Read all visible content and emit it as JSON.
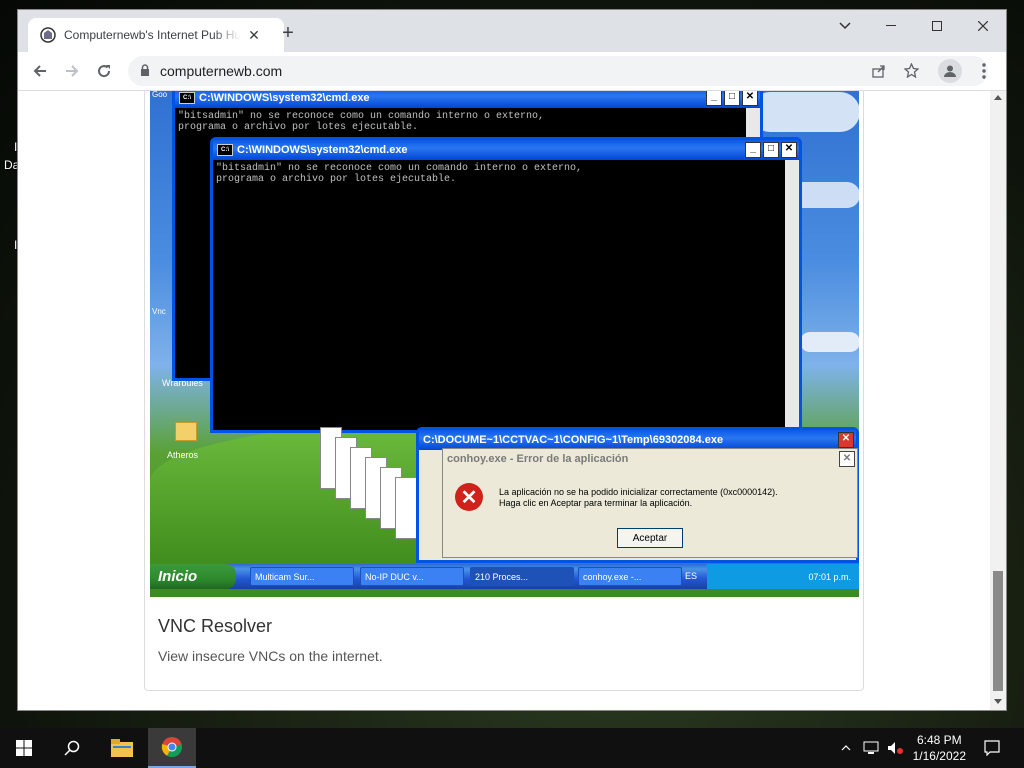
{
  "browser": {
    "tab_title": "Computernewb's Internet Pub Hub",
    "tab_close": "✕",
    "new_tab": "+",
    "url": "computernewb.com"
  },
  "desktop": {
    "side_label_1": "I",
    "side_label_2": "Da",
    "side_label_3": "I"
  },
  "card": {
    "title": "VNC Resolver",
    "description": "View insecure VNCs on the internet."
  },
  "vnc": {
    "cmd1_title": "C:\\WINDOWS\\system32\\cmd.exe",
    "cmd1_text": "\"bitsadmin\" no se reconoce como un comando interno o externo,\nprograma o archivo por lotes ejecutable.",
    "cmd2_title": "C:\\WINDOWS\\system32\\cmd.exe",
    "cmd2_text": "\"bitsadmin\" no se reconoce como un comando interno o externo,\nprograma o archivo por lotes ejecutable.",
    "temp_title": "C:\\DOCUME~1\\CCTVAC~1\\CONFIG~1\\Temp\\69302084.exe",
    "error_title": "conhoy.exe - Error de la aplicación",
    "error_message": "La aplicación no se ha podido inicializar correctamente (0xc0000142). Haga clic en Aceptar para terminar la aplicación.",
    "error_ok": "Aceptar",
    "desk_icon_1": "Goo",
    "desk_icon_winarbules": "Wrarbules",
    "desk_icon_atheros": "Atheros",
    "desk_icon_vnc": "Vnc",
    "start": "Inicio",
    "tasks": [
      "Multicam Sur...",
      "No-IP DUC v...",
      "210 Proces...",
      "conhoy.exe -..."
    ],
    "lang": "ES",
    "tray_time": "07:01 p.m."
  },
  "taskbar": {
    "time": "6:48 PM",
    "date": "1/16/2022"
  }
}
